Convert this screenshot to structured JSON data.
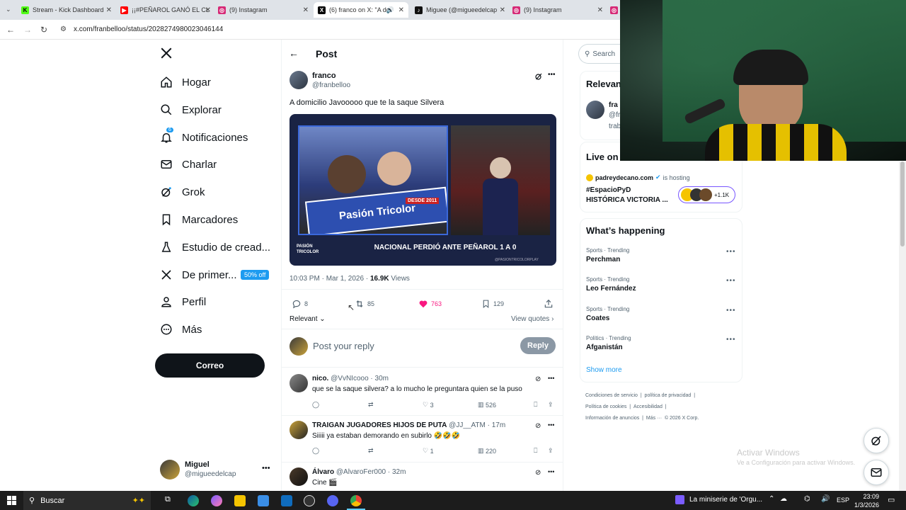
{
  "browser": {
    "tabs": [
      {
        "title": "Stream - Kick Dashboard",
        "fav_color": "#53fc18",
        "fav_text": "K"
      },
      {
        "title": "¡¡#PEÑAROL GANÓ EL CL",
        "fav_color": "#ff0000",
        "fav_text": "▶"
      },
      {
        "title": "(9) Instagram",
        "fav_color": "#d62976",
        "fav_text": "◎"
      },
      {
        "title": "(6) franco on X: \"A do",
        "fav_color": "#000000",
        "fav_text": "X"
      },
      {
        "title": "Miguee (@migueedelcap",
        "fav_color": "#111111",
        "fav_text": "♪"
      },
      {
        "title": "(9) Instagram",
        "fav_color": "#d62976",
        "fav_text": "◎"
      }
    ],
    "url": "x.com/franbelloo/status/2028274980023046144"
  },
  "nav": {
    "items": [
      {
        "label": "Hogar",
        "icon": "home-icon"
      },
      {
        "label": "Explorar",
        "icon": "search-icon"
      },
      {
        "label": "Notificaciones",
        "icon": "bell-icon"
      },
      {
        "label": "Charlar",
        "icon": "mail-icon"
      },
      {
        "label": "Grok",
        "icon": "grok-icon"
      },
      {
        "label": "Marcadores",
        "icon": "bookmark-icon"
      },
      {
        "label": "Estudio de cread...",
        "icon": "flask-icon"
      },
      {
        "label": "De primer...",
        "icon": "x-logo-icon"
      },
      {
        "label": "Perfil",
        "icon": "person-icon"
      },
      {
        "label": "Más",
        "icon": "more-circle-icon"
      }
    ],
    "notif_count": "6",
    "badge": "50% off",
    "post_button": "Correo",
    "account": {
      "name": "Miguel",
      "handle": "@migueedelcap"
    }
  },
  "post": {
    "header": "Post",
    "author": "franco",
    "handle": "@franbelloo",
    "text": "A domicilio Javooooo que te la saque Silvera",
    "image_caption": "NACIONAL PERDIÓ ANTE PEÑAROL 1 A 0",
    "image_logo": "PASIÓN TRICOLOR",
    "image_handle": "@PASIONTRICOLORPLAY",
    "banner_text": "Pasión Tricolor",
    "banner_sub": "DESDE 2011",
    "timestamp": "10:03 PM · Mar 1, 2026 · ",
    "views_count": "16.9K",
    "views_label": " Views",
    "replies": "8",
    "reposts": "85",
    "likes": "763",
    "bookmarks": "129",
    "sort_label": "Relevant",
    "view_quotes": "View quotes",
    "reply_placeholder": "Post your reply",
    "reply_button": "Reply"
  },
  "replies": [
    {
      "name": "nico.",
      "handle": "@VvNIcooo · 30m",
      "text": "que se la saque silvera? a lo mucho le preguntara quien se la puso",
      "reposts": "",
      "likes": "3",
      "views": "526"
    },
    {
      "name": "TRAIGAN JUGADORES HIJOS DE PUTA",
      "handle": "@JJ__ATM · 17m",
      "text": "Siiiii ya estaban demorando en subirlo 🤣🤣🤣",
      "reposts": "",
      "likes": "1",
      "views": "220"
    },
    {
      "name": "Álvaro",
      "handle": "@AlvaroFer000 · 32m",
      "text": "Cine 🎬"
    }
  ],
  "sidebar": {
    "search_placeholder": "Search",
    "relevant_title": "Relevan",
    "relevant_name": "fra",
    "relevant_handle": "@fr",
    "relevant_bio": "trab",
    "live_title": "Live on",
    "live_host": "padreydecano.com",
    "live_hosting": "is hosting",
    "live_line1": "#EspacioPyD",
    "live_line2": "HISTÓRICA VICTORIA ...",
    "live_count": "+1.1K",
    "happening_title": "What’s happening",
    "trends": [
      {
        "meta": "Sports · Trending",
        "name": "Perchman"
      },
      {
        "meta": "Sports · Trending",
        "name": "Leo Fernández"
      },
      {
        "meta": "Sports · Trending",
        "name": "Coates"
      },
      {
        "meta": "Politics · Trending",
        "name": "Afganistán"
      }
    ],
    "show_more": "Show more",
    "footer_line1": [
      "Condiciones de servicio",
      "|",
      "política de privacidad",
      "|"
    ],
    "footer_line2": [
      "Política de cookies",
      "|",
      "Accesibilidad",
      "|"
    ],
    "footer_line3": [
      "Información de anuncios",
      "|",
      "Más ···",
      "© 2026 X Corp."
    ]
  },
  "watermark": {
    "line1": "Activar Windows",
    "line2": "Ve a Configuración para activar Windows."
  },
  "taskbar": {
    "search": "Buscar",
    "media": "La miniserie de 'Orgu...",
    "lang": "ESP",
    "time": "23:09",
    "date": "1/3/2026"
  }
}
